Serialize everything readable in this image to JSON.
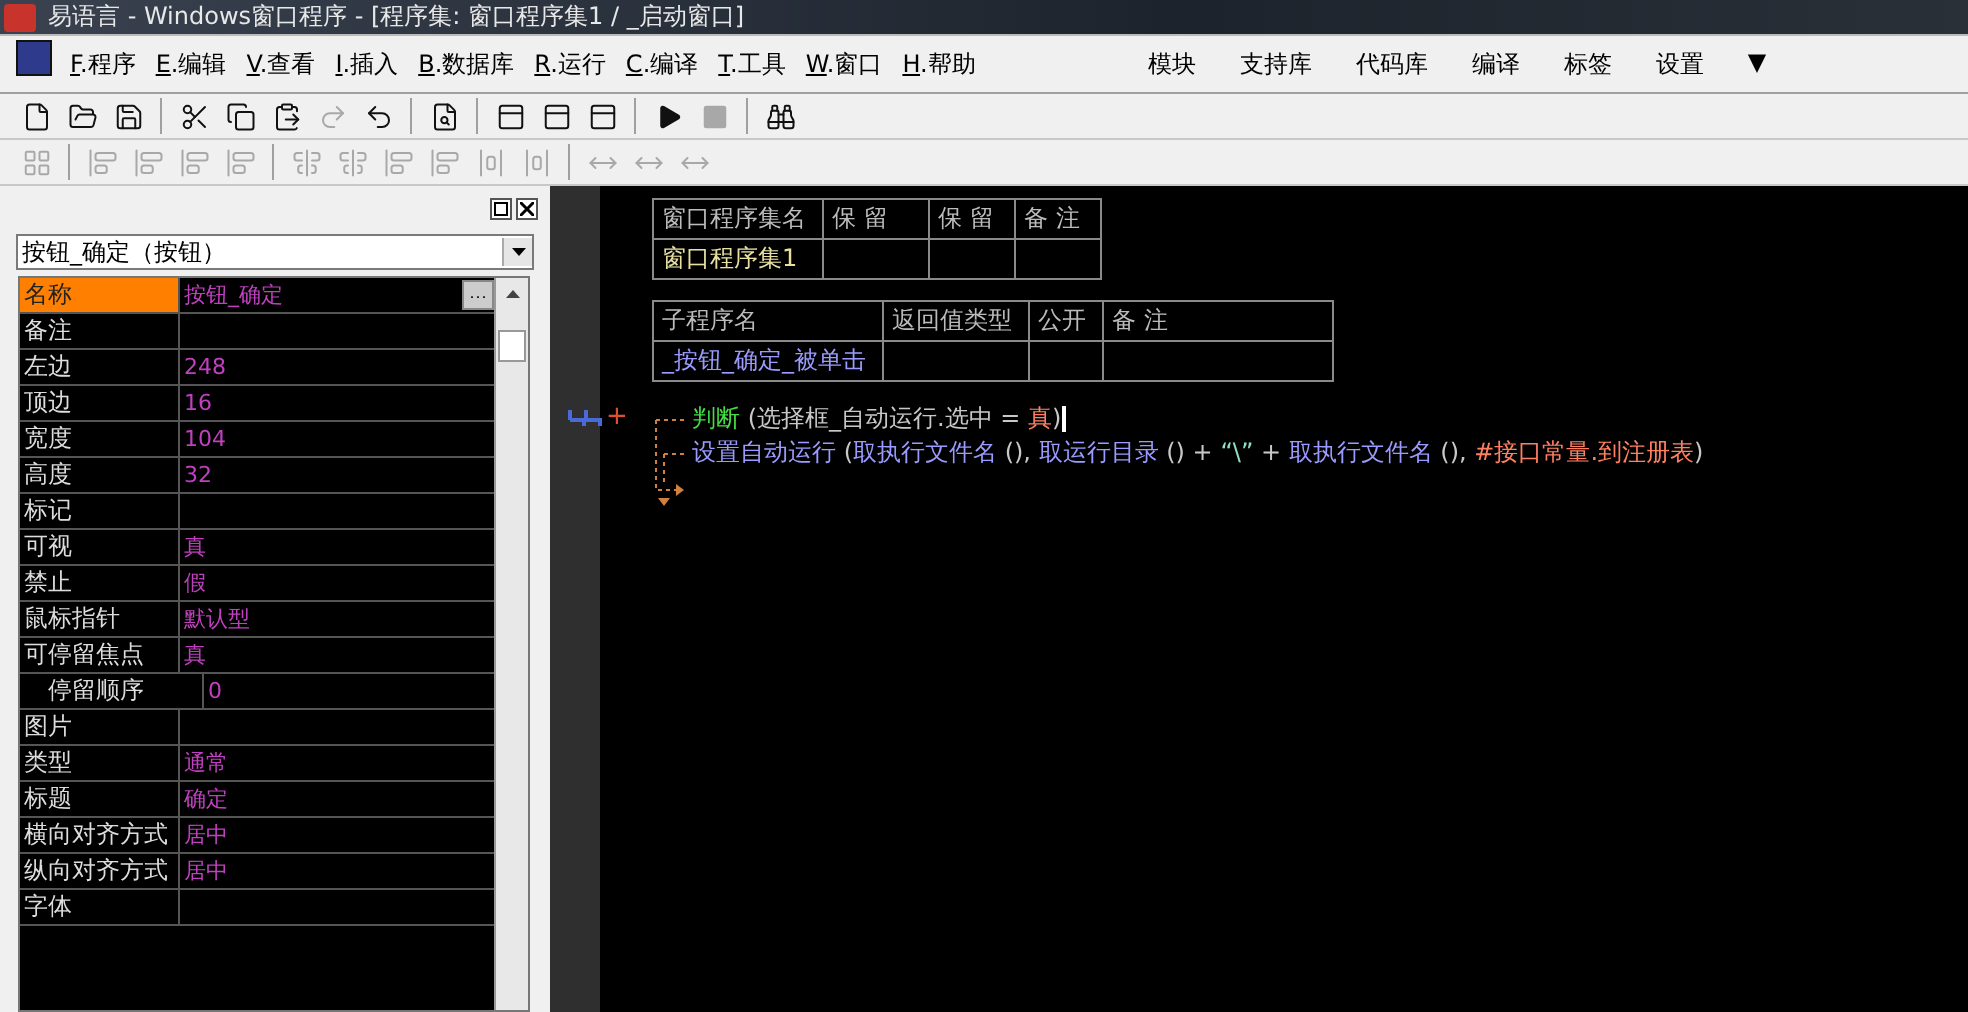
{
  "window": {
    "title": "易语言 - Windows窗口程序 - [程序集: 窗口程序集1 / _启动窗口]"
  },
  "menu": [
    {
      "key": "F",
      "label": ".程序"
    },
    {
      "key": "E",
      "label": ".编辑"
    },
    {
      "key": "V",
      "label": ".查看"
    },
    {
      "key": "I",
      "label": ".插入"
    },
    {
      "key": "B",
      "label": ".数据库"
    },
    {
      "key": "R",
      "label": ".运行"
    },
    {
      "key": "C",
      "label": ".编译"
    },
    {
      "key": "T",
      "label": ".工具"
    },
    {
      "key": "W",
      "label": ".窗口"
    },
    {
      "key": "H",
      "label": ".帮助"
    }
  ],
  "right_menu": [
    "模块",
    "支持库",
    "代码库",
    "编译",
    "标签",
    "设置",
    "▼"
  ],
  "toolbar": [
    {
      "kind": "new",
      "disabled": false
    },
    {
      "kind": "open",
      "disabled": false
    },
    {
      "kind": "save",
      "disabled": false
    },
    {
      "kind": "sep"
    },
    {
      "kind": "cut",
      "disabled": false
    },
    {
      "kind": "copy",
      "disabled": false
    },
    {
      "kind": "paste",
      "disabled": false
    },
    {
      "kind": "redo",
      "disabled": true
    },
    {
      "kind": "undo",
      "disabled": false
    },
    {
      "kind": "sep"
    },
    {
      "kind": "preview",
      "disabled": false
    },
    {
      "kind": "sep"
    },
    {
      "kind": "layout",
      "disabled": false
    },
    {
      "kind": "layout",
      "disabled": false
    },
    {
      "kind": "layout",
      "disabled": false
    },
    {
      "kind": "sep"
    },
    {
      "kind": "run",
      "disabled": false
    },
    {
      "kind": "stop",
      "disabled": true
    },
    {
      "kind": "sep"
    },
    {
      "kind": "find",
      "disabled": false
    }
  ],
  "align_toolbar": [
    {
      "kind": "grid",
      "disabled": true
    },
    {
      "kind": "sep"
    },
    {
      "kind": "align",
      "disabled": true
    },
    {
      "kind": "align",
      "disabled": true
    },
    {
      "kind": "align",
      "disabled": true
    },
    {
      "kind": "align",
      "disabled": true
    },
    {
      "kind": "sep"
    },
    {
      "kind": "center",
      "disabled": true
    },
    {
      "kind": "center",
      "disabled": true
    },
    {
      "kind": "align",
      "disabled": true
    },
    {
      "kind": "align",
      "disabled": true
    },
    {
      "kind": "space",
      "disabled": true
    },
    {
      "kind": "space",
      "disabled": true
    },
    {
      "kind": "sep"
    },
    {
      "kind": "size",
      "disabled": true
    },
    {
      "kind": "size",
      "disabled": true
    },
    {
      "kind": "size",
      "disabled": true
    }
  ],
  "properties": {
    "object": "按钮_确定（按钮）",
    "rows": [
      {
        "name": "名称",
        "value": "按钮_确定",
        "selected": true,
        "button": "···"
      },
      {
        "name": "备注",
        "selected": false
      },
      {
        "name": "左边",
        "value": "248",
        "selected": false
      },
      {
        "name": "顶边",
        "value": "16",
        "selected": false
      },
      {
        "name": "宽度",
        "value": "104",
        "selected": false
      },
      {
        "name": "高度",
        "value": "32",
        "selected": false
      },
      {
        "name": "标记",
        "selected": false
      },
      {
        "name": "可视",
        "value": "真",
        "selected": false
      },
      {
        "name": "禁止",
        "value": "假",
        "selected": false
      },
      {
        "name": "鼠标指针",
        "value": "默认型",
        "selected": false
      },
      {
        "name": "可停留焦点",
        "value": "真",
        "selected": false,
        "children": [
          {
            "name": "停留顺序",
            "value": "0",
            "selected": false
          }
        ]
      },
      {
        "name": "图片",
        "selected": false
      },
      {
        "name": "类型",
        "value": "通常",
        "selected": false
      },
      {
        "name": "标题",
        "value": "确定",
        "selected": false
      },
      {
        "name": "横向对齐方式",
        "value": "居中",
        "selected": false
      },
      {
        "name": "纵向对齐方式",
        "value": "居中",
        "selected": false
      },
      {
        "name": "字体",
        "selected": false
      }
    ]
  },
  "assembly_table": {
    "columns": [
      "窗口程序集名",
      "保 留",
      "保 留",
      "备 注"
    ],
    "row": {
      "name": "窗口程序集1"
    }
  },
  "sub_table": {
    "columns": [
      "子程序名",
      "返回值类型",
      "公开",
      "备 注"
    ],
    "row": {
      "name": "_按钮_确定_被单击"
    }
  },
  "gutter": {
    "mark": "+"
  },
  "code": [
    [
      {
        "kind": "keyword",
        "text": "判断"
      },
      {
        "kind": "plain",
        "text": " (选择框_自动运行.选中 = "
      },
      {
        "kind": "constant",
        "text": "真"
      },
      {
        "kind": "plain",
        "text": ")"
      }
    ],
    [
      {
        "kind": "command",
        "text": "设置自动运行"
      },
      {
        "kind": "plain",
        "text": " ("
      },
      {
        "kind": "command",
        "text": "取执行文件名"
      },
      {
        "kind": "plain",
        "text": " (), "
      },
      {
        "kind": "command",
        "text": "取运行目录"
      },
      {
        "kind": "plain",
        "text": " () + "
      },
      {
        "kind": "string",
        "text": "“\\”"
      },
      {
        "kind": "plain",
        "text": " + "
      },
      {
        "kind": "command",
        "text": "取执行文件名"
      },
      {
        "kind": "plain",
        "text": " (), "
      },
      {
        "kind": "constant",
        "text": "#接口常量.到注册表"
      },
      {
        "kind": "plain",
        "text": ")"
      }
    ]
  ]
}
